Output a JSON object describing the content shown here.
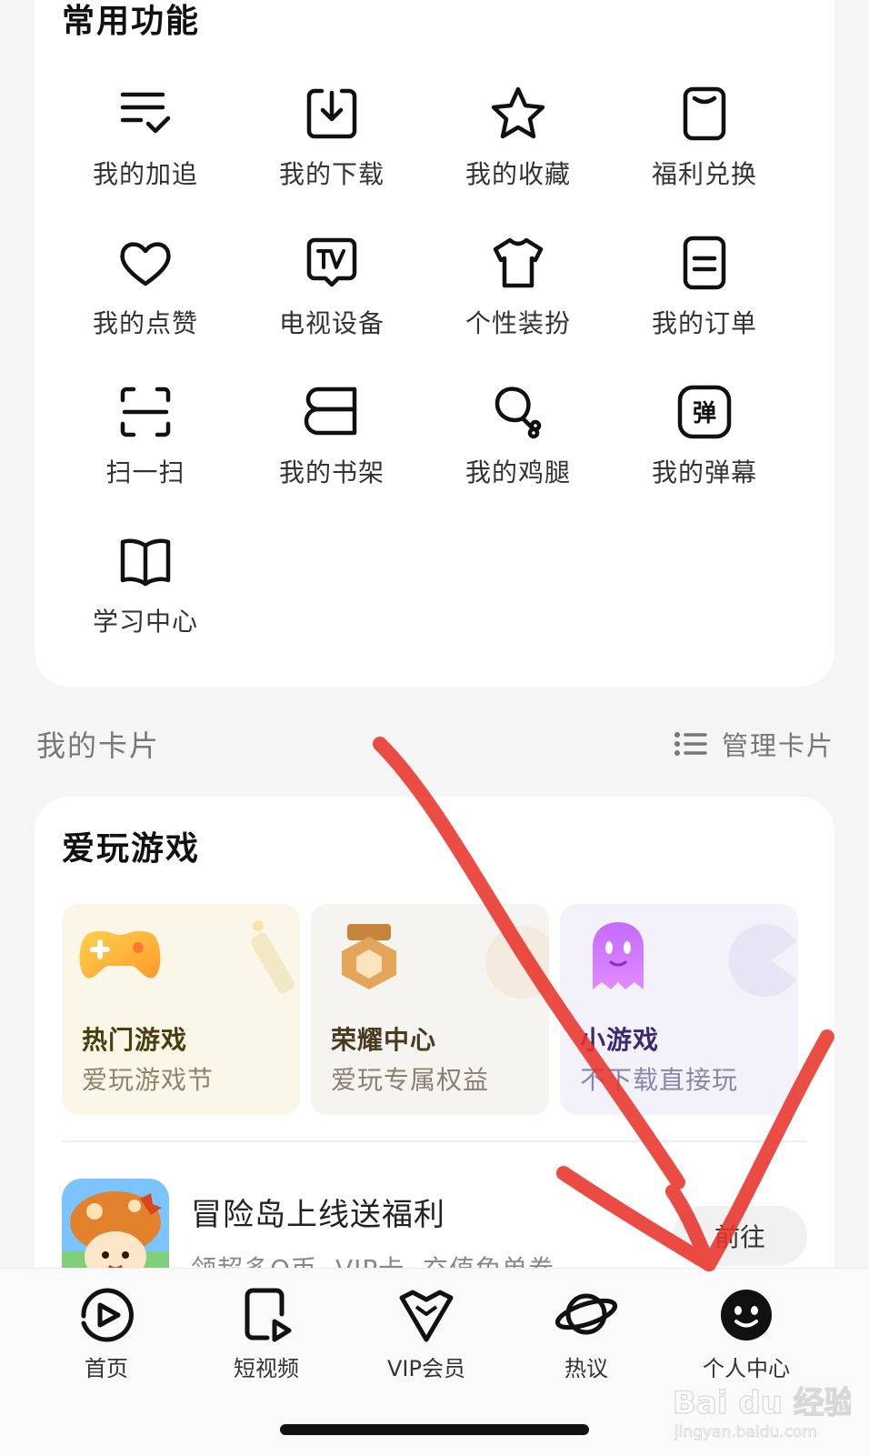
{
  "common_functions": {
    "title": "常用功能",
    "items": [
      {
        "label": "我的加追",
        "icon": "list-check-icon"
      },
      {
        "label": "我的下载",
        "icon": "download-icon"
      },
      {
        "label": "我的收藏",
        "icon": "star-icon"
      },
      {
        "label": "福利兑换",
        "icon": "gift-card-icon"
      },
      {
        "label": "我的点赞",
        "icon": "heart-icon"
      },
      {
        "label": "电视设备",
        "icon": "tv-icon"
      },
      {
        "label": "个性装扮",
        "icon": "shirt-icon"
      },
      {
        "label": "我的订单",
        "icon": "order-icon"
      },
      {
        "label": "扫一扫",
        "icon": "scan-icon"
      },
      {
        "label": "我的书架",
        "icon": "bookshelf-icon"
      },
      {
        "label": "我的鸡腿",
        "icon": "drumstick-icon"
      },
      {
        "label": "我的弹幕",
        "icon": "danmaku-icon"
      },
      {
        "label": "学习中心",
        "icon": "book-icon"
      }
    ]
  },
  "my_cards": {
    "title": "我的卡片",
    "manage_label": "管理卡片",
    "manage_icon": "list-icon"
  },
  "games": {
    "title": "爱玩游戏",
    "tiles": [
      {
        "title": "热门游戏",
        "subtitle": "爱玩游戏节",
        "icon": "gamepad-icon",
        "title_color": "#4a3d10",
        "subtitle_color": "#8c8470",
        "bg": "#fbf7e8"
      },
      {
        "title": "荣耀中心",
        "subtitle": "爱玩专属权益",
        "icon": "medal-icon",
        "title_color": "#4a3a20",
        "subtitle_color": "#8a7f70",
        "bg": "#f6f4f1"
      },
      {
        "title": "小游戏",
        "subtitle": "不下载直接玩",
        "icon": "ghost-icon",
        "title_color": "#3b2a70",
        "subtitle_color": "#8a86a8",
        "bg": "#f3f2fb"
      }
    ],
    "promo": {
      "title": "冒险岛上线送福利",
      "subtitle": "领超多Q币 VIP卡 充值免单券",
      "button": "前往",
      "icon": "mushroom-avatar-icon"
    }
  },
  "bottom_nav": [
    {
      "label": "首页",
      "icon": "play-icon"
    },
    {
      "label": "短视频",
      "icon": "short-video-icon"
    },
    {
      "label": "VIP会员",
      "icon": "vip-crown-icon"
    },
    {
      "label": "热议",
      "icon": "planet-icon"
    },
    {
      "label": "个人中心",
      "icon": "profile-face-icon"
    }
  ],
  "watermark": {
    "brand": "Bai du 经验",
    "url": "jingyan.baidu.com"
  },
  "colors": {
    "accent": "#111111",
    "annotation": "#e8332a",
    "background": "#f5f5f5"
  }
}
